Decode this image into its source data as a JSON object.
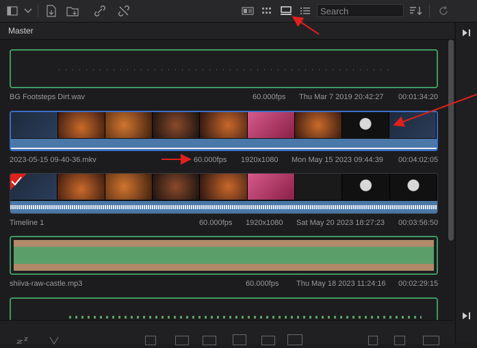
{
  "toolbar": {
    "icons": [
      "sidebar-toggle-icon",
      "chevron-down-icon",
      "import-media-icon",
      "import-folder-icon",
      "link-icon",
      "unlink-icon",
      "metadata-view-icon",
      "thumbnail-view-icon",
      "filmstrip-view-icon",
      "list-view-icon",
      "sort-icon",
      "refresh-icon"
    ],
    "search_placeholder": "Search"
  },
  "header": {
    "title": "Master"
  },
  "clips": [
    {
      "name": "BG Footsteps Dirt.wav",
      "fps": "60.000fps",
      "resolution": "",
      "date": "Thu Mar 7 2019 20:42:27",
      "duration": "00:01:34:20",
      "type": "audio"
    },
    {
      "name": "2023-05-15 09-40-36.mkv",
      "fps": "60.000fps",
      "resolution": "1920x1080",
      "date": "Mon May 15 2023 09:44:39",
      "duration": "00:04:02:05",
      "type": "video"
    },
    {
      "name": "Timeline 1",
      "fps": "60.000fps",
      "resolution": "1920x1080",
      "date": "Sat May 20 2023 18:27:23",
      "duration": "00:03:56:50",
      "type": "timeline"
    },
    {
      "name": "shiiva-raw-castle.mp3",
      "fps": "60.000fps",
      "resolution": "",
      "date": "Thu May 18 2023 11:24:16",
      "duration": "00:02:29:15",
      "type": "audio"
    }
  ],
  "colors": {
    "audio_border": "#3f9a64",
    "selected_border": "#3a6fc8",
    "annotation_arrow": "#e0201c",
    "waveform_blue": "#4a78a8",
    "waveform_green": "#5b9e6a"
  }
}
